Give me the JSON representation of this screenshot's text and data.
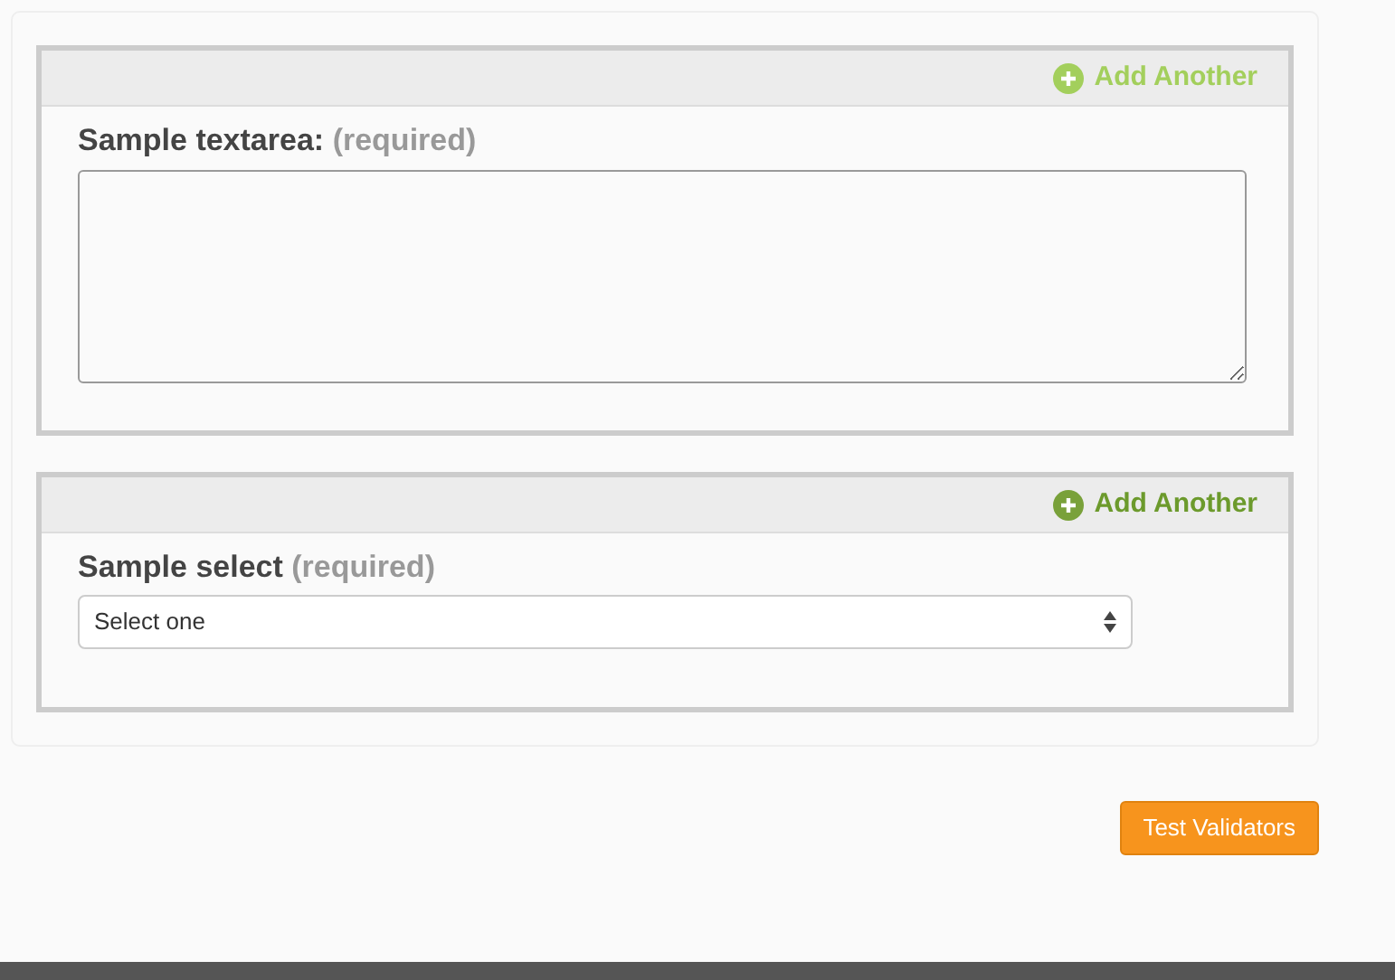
{
  "sections": [
    {
      "kind": "textarea",
      "add_button": {
        "label": "Add Another",
        "hovered": true
      },
      "label": "Sample textarea:",
      "required": "(required)"
    },
    {
      "kind": "select",
      "add_button": {
        "label": "Add Another",
        "hovered": false
      },
      "label": "Sample select",
      "required": "(required)",
      "value": "Select one"
    }
  ],
  "submit_button": "Test Validators"
}
